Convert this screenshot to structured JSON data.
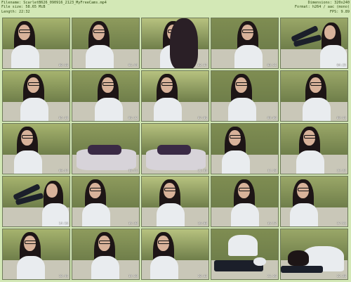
{
  "header": {
    "filename": "Filename: ScarletB626_090916_2123_MyFreeCams.mp4",
    "filesize": "File size: 58.65 MiB",
    "length": "Length: 22:32",
    "dimensions": "Dimensions: 320x240",
    "format": "Format: h264 / aac (mono)",
    "fps": "FPS: 9.89"
  },
  "thumbnails": [
    {
      "time": "00:50",
      "scene": "girl"
    },
    {
      "time": "01:44",
      "scene": "girl"
    },
    {
      "time": "02:37",
      "scene": "closeup"
    },
    {
      "time": "03:31",
      "scene": "girl"
    },
    {
      "time": "04:25",
      "scene": "legs"
    },
    {
      "time": "05:18",
      "scene": "girl"
    },
    {
      "time": "06:12",
      "scene": "girl"
    },
    {
      "time": "07:06",
      "scene": "girl"
    },
    {
      "time": "08:00",
      "scene": "girl"
    },
    {
      "time": "08:53",
      "scene": "girl"
    },
    {
      "time": "09:47",
      "scene": "girl"
    },
    {
      "time": "10:41",
      "scene": "bed"
    },
    {
      "time": "11:35",
      "scene": "bed"
    },
    {
      "time": "12:28",
      "scene": "girl"
    },
    {
      "time": "13:22",
      "scene": "girl"
    },
    {
      "time": "14:16",
      "scene": "legs"
    },
    {
      "time": "15:10",
      "scene": "girl"
    },
    {
      "time": "16:03",
      "scene": "girl"
    },
    {
      "time": "16:57",
      "scene": "girl"
    },
    {
      "time": "17:51",
      "scene": "girl"
    },
    {
      "time": "18:45",
      "scene": "girl"
    },
    {
      "time": "19:38",
      "scene": "girl"
    },
    {
      "time": "20:32",
      "scene": "girl"
    },
    {
      "time": "21:26",
      "scene": "feet"
    },
    {
      "time": "22:20",
      "scene": "lying"
    }
  ],
  "colors": {
    "background": "#d3e8b6",
    "text": "#2f4a12",
    "wall_a": "#a6b36e",
    "wall_b": "#6f7e4a",
    "shirt": "#e9ecef",
    "hair": "#1d1516"
  }
}
